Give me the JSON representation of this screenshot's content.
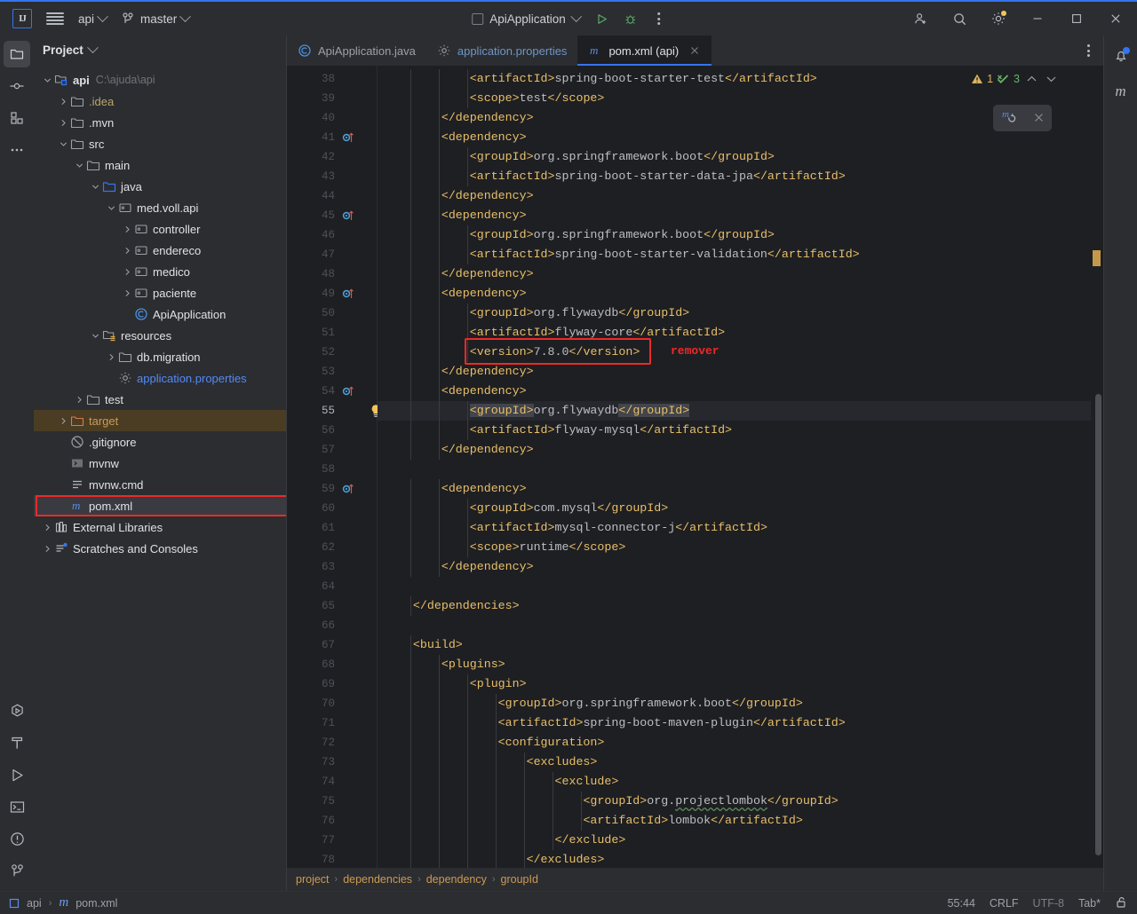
{
  "titlebar": {
    "logo": "IJ",
    "menu_icon": "hamburger-icon",
    "project_name": "api",
    "vcs_icon": "git-branch-icon",
    "branch_name": "master",
    "run_config": "ApiApplication",
    "run_icon": "run-icon",
    "debug_icon": "debug-icon",
    "more_icon": "more-vertical-icon",
    "account_icon": "add-user-icon",
    "search_icon": "search-icon",
    "settings_icon": "gear-icon",
    "minimize": "minimize-icon",
    "maximize": "maximize-icon",
    "close": "close-icon"
  },
  "left_strip": {
    "top": [
      {
        "name": "project-tool-icon",
        "active": true
      },
      {
        "name": "commit-tool-icon",
        "active": false
      },
      {
        "name": "structure-tool-icon",
        "active": false
      },
      {
        "name": "more-tool-icon",
        "active": false
      }
    ],
    "bottom": [
      {
        "name": "services-tool-icon"
      },
      {
        "name": "build-tool-icon"
      },
      {
        "name": "run-tool-icon"
      },
      {
        "name": "terminal-tool-icon"
      },
      {
        "name": "problems-tool-icon"
      },
      {
        "name": "git-tool-icon"
      }
    ]
  },
  "right_strip": {
    "notifications": "notifications-icon",
    "maven": "maven-icon"
  },
  "project_panel": {
    "title": "Project",
    "tree": [
      {
        "depth": 0,
        "arrow": "down",
        "icon": "module-icon",
        "label": "api",
        "path": "C:\\ajuda\\api",
        "style": "bold"
      },
      {
        "depth": 1,
        "arrow": "right",
        "icon": "folder-icon",
        "label": ".idea",
        "style": "yellowish"
      },
      {
        "depth": 1,
        "arrow": "right",
        "icon": "folder-icon",
        "label": ".mvn",
        "style": "plain"
      },
      {
        "depth": 1,
        "arrow": "down",
        "icon": "folder-icon",
        "label": "src",
        "style": "plain"
      },
      {
        "depth": 2,
        "arrow": "down",
        "icon": "folder-icon",
        "label": "main",
        "style": "plain"
      },
      {
        "depth": 3,
        "arrow": "down",
        "icon": "source-root-icon",
        "label": "java",
        "style": "plain"
      },
      {
        "depth": 4,
        "arrow": "down",
        "icon": "package-icon",
        "label": "med.voll.api",
        "style": "plain"
      },
      {
        "depth": 5,
        "arrow": "right",
        "icon": "package-icon",
        "label": "controller",
        "style": "plain"
      },
      {
        "depth": 5,
        "arrow": "right",
        "icon": "package-icon",
        "label": "endereco",
        "style": "plain"
      },
      {
        "depth": 5,
        "arrow": "right",
        "icon": "package-icon",
        "label": "medico",
        "style": "plain"
      },
      {
        "depth": 5,
        "arrow": "right",
        "icon": "package-icon",
        "label": "paciente",
        "style": "plain"
      },
      {
        "depth": 5,
        "arrow": "none",
        "icon": "java-class-icon",
        "label": "ApiApplication",
        "style": "plain"
      },
      {
        "depth": 3,
        "arrow": "down",
        "icon": "resource-root-icon",
        "label": "resources",
        "style": "plain"
      },
      {
        "depth": 4,
        "arrow": "right",
        "icon": "folder-icon",
        "label": "db.migration",
        "style": "plain"
      },
      {
        "depth": 4,
        "arrow": "none",
        "icon": "properties-icon",
        "label": "application.properties",
        "style": "link"
      },
      {
        "depth": 2,
        "arrow": "right",
        "icon": "folder-icon",
        "label": "test",
        "style": "plain"
      },
      {
        "depth": 1,
        "arrow": "right",
        "icon": "excluded-folder-icon",
        "label": "target",
        "style": "orange",
        "row": "sel-target"
      },
      {
        "depth": 1,
        "arrow": "none",
        "icon": "gitignore-icon",
        "label": ".gitignore",
        "style": "plain"
      },
      {
        "depth": 1,
        "arrow": "none",
        "icon": "shell-script-icon",
        "label": "mvnw",
        "style": "plain"
      },
      {
        "depth": 1,
        "arrow": "none",
        "icon": "cmd-file-icon",
        "label": "mvnw.cmd",
        "style": "plain"
      },
      {
        "depth": 1,
        "arrow": "none",
        "icon": "maven-file-icon",
        "label": "pom.xml",
        "style": "plain",
        "row": "sel-pom",
        "highlight": "red"
      },
      {
        "depth": 0,
        "arrow": "right",
        "icon": "libraries-icon",
        "label": "External Libraries",
        "style": "plain"
      },
      {
        "depth": 0,
        "arrow": "right",
        "icon": "scratches-icon",
        "label": "Scratches and Consoles",
        "style": "plain"
      }
    ]
  },
  "tabs": [
    {
      "label": "ApiApplication.java",
      "icon": "java-class-icon",
      "active": false,
      "closable": false
    },
    {
      "label": "application.properties",
      "icon": "properties-icon",
      "active": false,
      "closable": false
    },
    {
      "label": "pom.xml (api)",
      "icon": "maven-file-icon",
      "active": true,
      "closable": true
    }
  ],
  "tab_overflow_icon": "more-vertical-icon",
  "inspection_widget": {
    "warning_icon": "warning-triangle-icon",
    "warning_count": "1",
    "ok_icon": "inspections-ok-icon",
    "ok_count": "3",
    "prev_icon": "chevron-up-icon",
    "next_icon": "chevron-down-icon"
  },
  "maven_popup": {
    "reload_icon": "maven-reload-icon",
    "close_icon": "close-icon"
  },
  "annotation": {
    "label": "remover",
    "color": "#ec2a2a",
    "target_line": 52
  },
  "editor": {
    "first_line": 38,
    "current_line": 55,
    "lines": [
      {
        "n": 38,
        "indent": 3,
        "code": "<artifactId>spring-boot-starter-test</artifactId>"
      },
      {
        "n": 39,
        "indent": 3,
        "code": "<scope>test</scope>"
      },
      {
        "n": 40,
        "indent": 2,
        "code": "</dependency>"
      },
      {
        "n": 41,
        "indent": 2,
        "code": "<dependency>",
        "gutter": "maven-dependency-icon"
      },
      {
        "n": 42,
        "indent": 3,
        "code": "<groupId>org.springframework.boot</groupId>"
      },
      {
        "n": 43,
        "indent": 3,
        "code": "<artifactId>spring-boot-starter-data-jpa</artifactId>"
      },
      {
        "n": 44,
        "indent": 2,
        "code": "</dependency>"
      },
      {
        "n": 45,
        "indent": 2,
        "code": "<dependency>",
        "gutter": "maven-dependency-icon"
      },
      {
        "n": 46,
        "indent": 3,
        "code": "<groupId>org.springframework.boot</groupId>"
      },
      {
        "n": 47,
        "indent": 3,
        "code": "<artifactId>spring-boot-starter-validation</artifactId>"
      },
      {
        "n": 48,
        "indent": 2,
        "code": "</dependency>"
      },
      {
        "n": 49,
        "indent": 2,
        "code": "<dependency>",
        "gutter": "maven-dependency-icon"
      },
      {
        "n": 50,
        "indent": 3,
        "code": "<groupId>org.flywaydb</groupId>"
      },
      {
        "n": 51,
        "indent": 3,
        "code": "<artifactId>flyway-core</artifactId>"
      },
      {
        "n": 52,
        "indent": 3,
        "code": "<version>7.8.0</version>"
      },
      {
        "n": 53,
        "indent": 2,
        "code": "</dependency>"
      },
      {
        "n": 54,
        "indent": 2,
        "code": "<dependency>",
        "gutter": "maven-dependency-icon"
      },
      {
        "n": 55,
        "indent": 3,
        "code": "<groupId>org.flywaydb</groupId>",
        "current": true,
        "gutter": "intention-bulb-icon",
        "selection": true
      },
      {
        "n": 56,
        "indent": 3,
        "code": "<artifactId>flyway-mysql</artifactId>"
      },
      {
        "n": 57,
        "indent": 2,
        "code": "</dependency>"
      },
      {
        "n": 58,
        "indent": 0,
        "code": ""
      },
      {
        "n": 59,
        "indent": 2,
        "code": "<dependency>",
        "gutter": "maven-dependency-icon"
      },
      {
        "n": 60,
        "indent": 3,
        "code": "<groupId>com.mysql</groupId>"
      },
      {
        "n": 61,
        "indent": 3,
        "code": "<artifactId>mysql-connector-j</artifactId>"
      },
      {
        "n": 62,
        "indent": 3,
        "code": "<scope>runtime</scope>"
      },
      {
        "n": 63,
        "indent": 2,
        "code": "</dependency>"
      },
      {
        "n": 64,
        "indent": 0,
        "code": ""
      },
      {
        "n": 65,
        "indent": 1,
        "code": "</dependencies>"
      },
      {
        "n": 66,
        "indent": 0,
        "code": ""
      },
      {
        "n": 67,
        "indent": 1,
        "code": "<build>"
      },
      {
        "n": 68,
        "indent": 2,
        "code": "<plugins>"
      },
      {
        "n": 69,
        "indent": 3,
        "code": "<plugin>"
      },
      {
        "n": 70,
        "indent": 4,
        "code": "<groupId>org.springframework.boot</groupId>"
      },
      {
        "n": 71,
        "indent": 4,
        "code": "<artifactId>spring-boot-maven-plugin</artifactId>"
      },
      {
        "n": 72,
        "indent": 4,
        "code": "<configuration>"
      },
      {
        "n": 73,
        "indent": 5,
        "code": "<excludes>"
      },
      {
        "n": 74,
        "indent": 6,
        "code": "<exclude>"
      },
      {
        "n": 75,
        "indent": 7,
        "code": "<groupId>org.projectlombok</groupId>",
        "squiggle": "projectlombok"
      },
      {
        "n": 76,
        "indent": 7,
        "code": "<artifactId>lombok</artifactId>"
      },
      {
        "n": 77,
        "indent": 6,
        "code": "</exclude>"
      },
      {
        "n": 78,
        "indent": 5,
        "code": "</excludes>"
      }
    ]
  },
  "breadcrumbs": [
    "project",
    "dependencies",
    "dependency",
    "groupId"
  ],
  "statusbar": {
    "module_icon": "module-icon",
    "module": "api",
    "file_icon": "maven-file-icon",
    "file": "pom.xml",
    "caret": "55:44",
    "line_separator": "CRLF",
    "encoding": "UTF-8",
    "indent": "Tab*",
    "lock_icon": "unlocked-icon"
  },
  "colors": {
    "accent": "#3574f0",
    "tag": "#e8bf6a",
    "text": "#bcbec4",
    "annotation_red": "#ec2a2a",
    "warning": "#d9b360",
    "panel_bg": "#2b2d30",
    "editor_bg": "#1e1f22"
  }
}
